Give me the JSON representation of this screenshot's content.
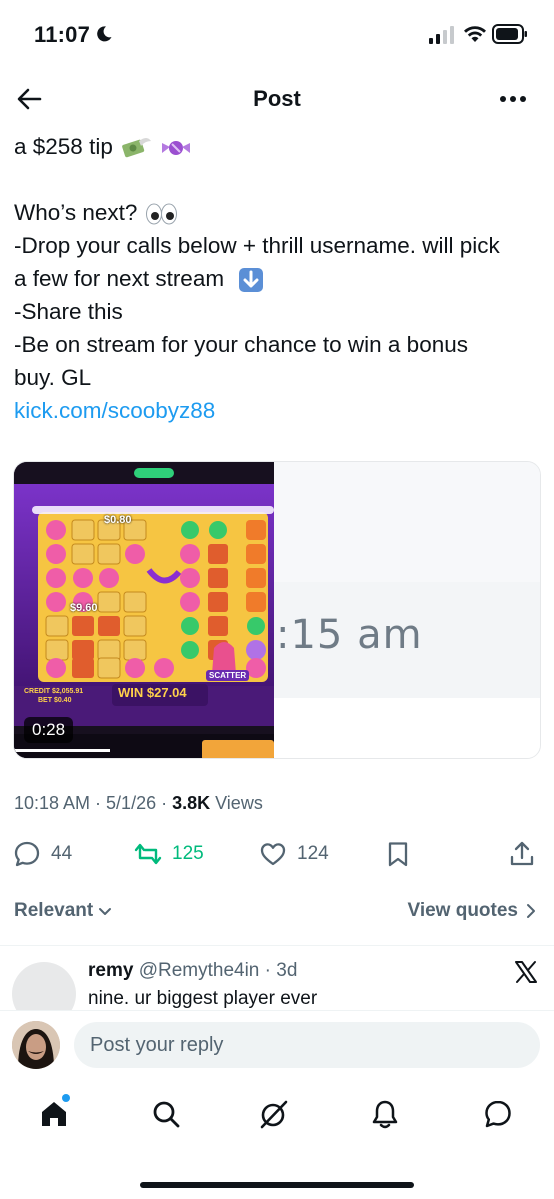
{
  "status_bar": {
    "time": "11:07"
  },
  "header": {
    "title": "Post"
  },
  "post": {
    "lines": [
      "a $258 tip",
      "",
      "Who’s next?",
      "-Drop your calls below + thrill username. will pick",
      "a few for next stream",
      "-Share this",
      "-Be on stream for your chance to win a bonus",
      "buy. GL"
    ],
    "link": "kick.com/scoobyz88",
    "media": {
      "video_duration": "0:28",
      "video_win_text": "WIN $27.04",
      "video_scatter_label": "SCATTER",
      "video_credit_text": "CREDIT $2,055.91",
      "video_bet_text": "BET $0.40",
      "video_tile_value_1": "$0.80",
      "video_tile_value_2": "$9.60",
      "preview_text": ":15 am"
    },
    "timestamp": "10:18 AM · 5/1/26 · ",
    "views_count": "3.8K",
    "views_label": " Views"
  },
  "actions": {
    "replies": "44",
    "retweets": "125",
    "likes": "124"
  },
  "sort": {
    "relevant_label": "Relevant",
    "quotes_label": "View quotes"
  },
  "reply": {
    "name": "remy",
    "handle": "@Remythe4in",
    "age": "3d",
    "text": "nine. ur biggest player ever"
  },
  "composer": {
    "placeholder": "Post your reply"
  },
  "colors": {
    "accent": "#1d9bf0",
    "retweet": "#00ba7c",
    "muted": "#536471"
  }
}
